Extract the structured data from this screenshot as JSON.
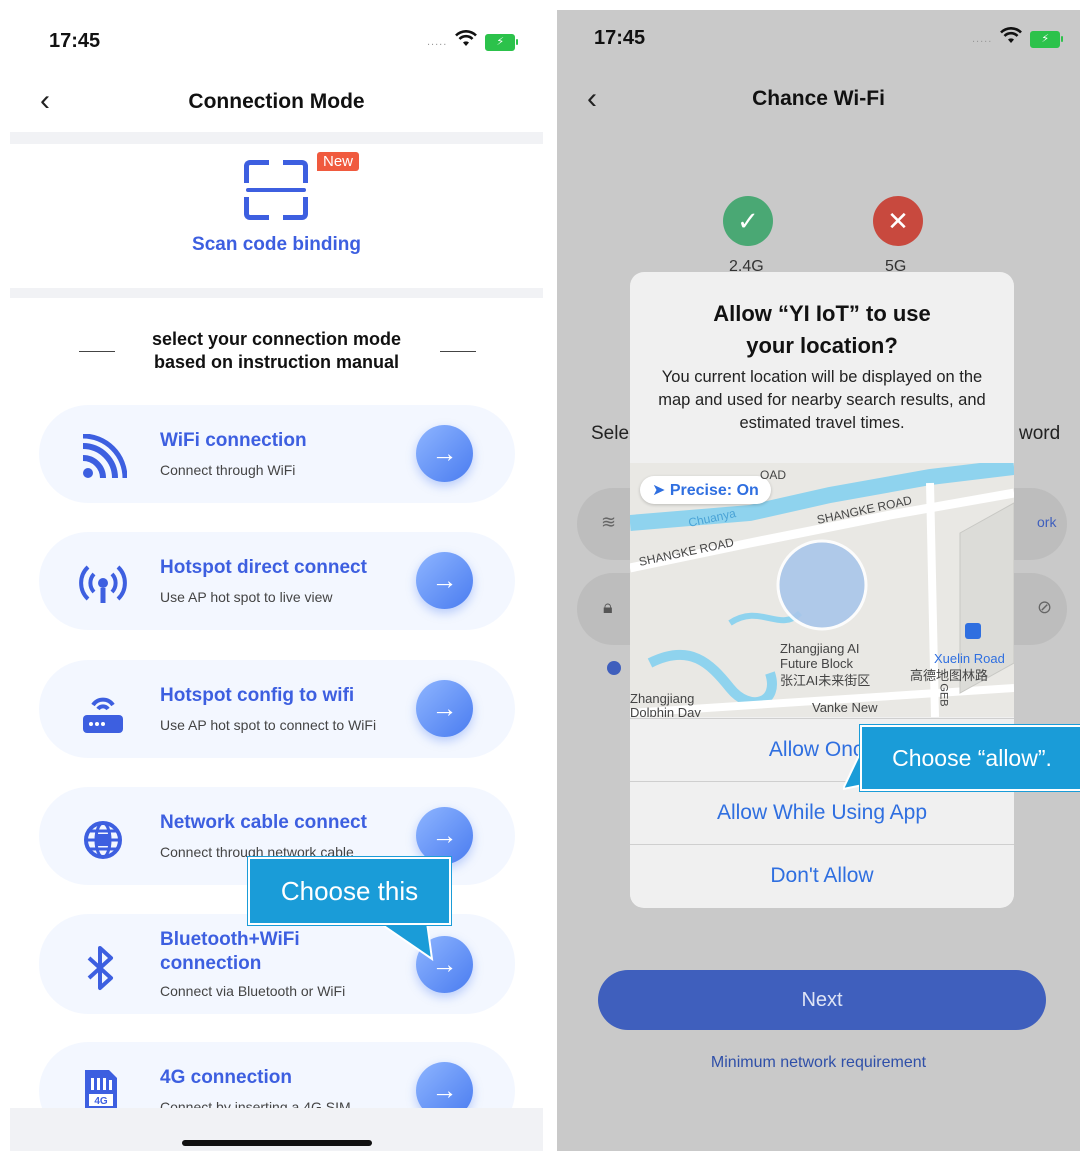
{
  "left": {
    "status": {
      "time": "17:45",
      "dots": ".....",
      "battery_glyph": "⚡"
    },
    "nav": {
      "back": "‹",
      "title": "Connection Mode"
    },
    "scan": {
      "badge": "New",
      "label": "Scan code binding"
    },
    "section_title_line1": "select your connection mode",
    "section_title_line2": "based on instruction manual",
    "modes": [
      {
        "title": "WiFi connection",
        "subtitle": "Connect through WiFi",
        "icon": "wifi-signal-icon"
      },
      {
        "title": "Hotspot direct connect",
        "subtitle": "Use AP hot spot to live view",
        "icon": "hotspot-icon"
      },
      {
        "title": "Hotspot config to wifi",
        "subtitle": "Use AP hot spot to connect to WiFi",
        "icon": "router-icon"
      },
      {
        "title": "Network cable connect",
        "subtitle": "Connect through network cable",
        "icon": "globe-network-icon"
      },
      {
        "title_line1": "Bluetooth+WiFi",
        "title_line2": "connection",
        "subtitle": "Connect via Bluetooth or WiFi",
        "icon": "bluetooth-icon"
      },
      {
        "title": "4G connection",
        "subtitle": "Connect by inserting a 4G SIM",
        "icon": "sim-card-icon",
        "icon_text": "4G"
      }
    ],
    "arrow_glyph": "→",
    "callout": "Choose this"
  },
  "right": {
    "status": {
      "time": "17:45",
      "dots": ".....",
      "battery_glyph": "⚡"
    },
    "nav": {
      "back": "‹",
      "title": "Chance Wi-Fi"
    },
    "steps": [
      {
        "label": "2.4G",
        "glyph": "✓",
        "color": "#4aa874"
      },
      {
        "label": "5G",
        "glyph": "✕",
        "color": "#c8493e"
      }
    ],
    "bg_left_partial": "Sele",
    "bg_right_partial": "word",
    "bg_row1_partial": "ork",
    "alert": {
      "title_line1": "Allow “YI IoT” to use",
      "title_line2": "your location?",
      "message": "You current location will be displayed on the map and used for nearby search results, and estimated travel times.",
      "precise": "➤ Precise: On",
      "map_labels": {
        "road1": "SHANGKE ROAD",
        "road2": "SHANGKE ROAD",
        "road3": "OAD",
        "river": "Chuanya",
        "block_en1": "Zhangjiang AI",
        "block_en2": "Future Block",
        "block_cn": "张江AI未来街区",
        "xuelin": "Xuelin Road",
        "xuelin_cn": "高德地图林路",
        "dolphin1": "Zhangjiang",
        "dolphin2": "Dolphin Day",
        "vanke": "Vanke New",
        "geb": "GEB"
      },
      "buttons": [
        "Allow Once",
        "Allow While Using App",
        "Don't Allow"
      ]
    },
    "next": "Next",
    "min_link": "Minimum network requirement",
    "callout": "Choose “allow”."
  }
}
